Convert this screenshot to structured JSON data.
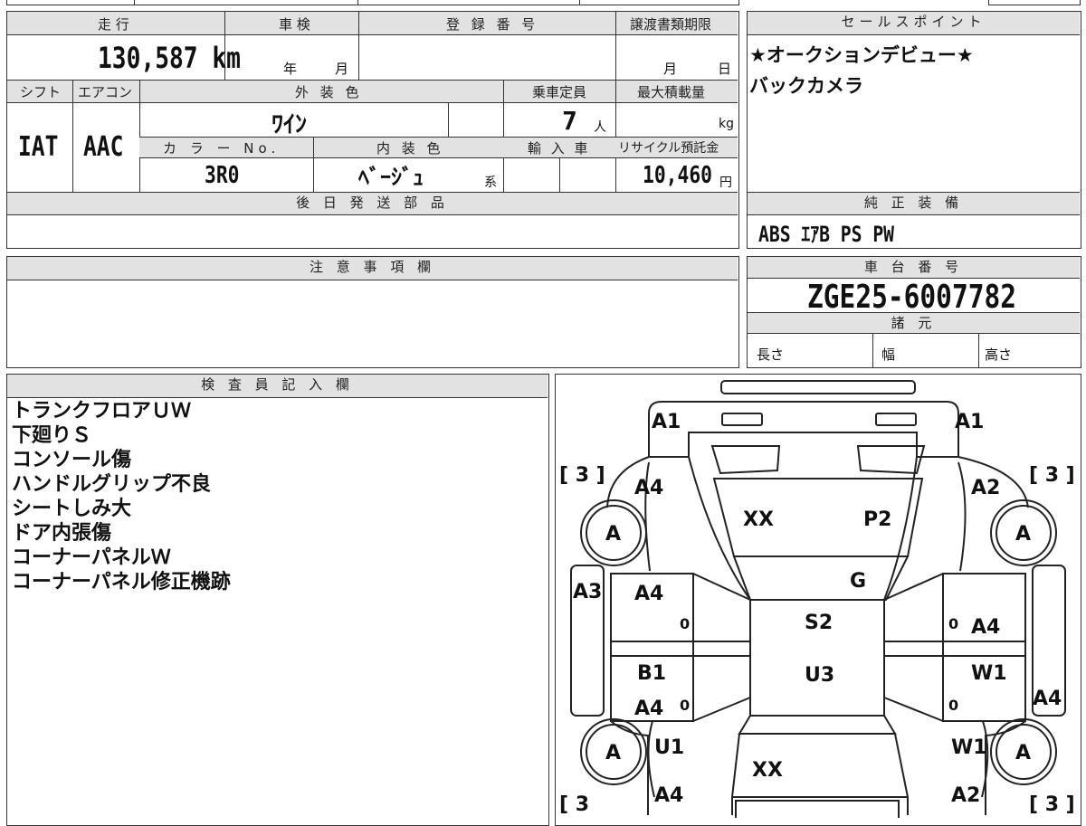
{
  "top_strip": {
    "label": ""
  },
  "specs": {
    "mileage": {
      "label": "走 行",
      "value": "130,587 km"
    },
    "inspection": {
      "label": "車 検",
      "year_unit": "年",
      "month_unit": "月"
    },
    "registration": {
      "label": "登 録 番 号",
      "value": ""
    },
    "transfer_deadline": {
      "label": "譲渡書類期限",
      "month_unit": "月",
      "day_unit": "日"
    },
    "shift": {
      "label": "シフト",
      "value": "IAT"
    },
    "aircon": {
      "label": "エアコン",
      "value": "AAC"
    },
    "exterior_color": {
      "label": "外 装 色",
      "value": "ﾜｲﾝ"
    },
    "capacity": {
      "label": "乗車定員",
      "value": "7",
      "unit": "人"
    },
    "max_load": {
      "label": "最大積載量",
      "unit": "kg"
    },
    "color_no": {
      "label": "カ ラ ー No.",
      "value": "3R0"
    },
    "interior_color": {
      "label": "内 装 色",
      "value": "ﾍﾞｰｼﾞｭ",
      "suffix": "系"
    },
    "import": {
      "label": "輸 入 車"
    },
    "recycle_fee": {
      "label": "リサイクル預託金",
      "value": "10,460",
      "unit": "円"
    }
  },
  "sales_points": {
    "label": "セールスポイント",
    "lines": [
      "★オークションデビュー★",
      "バックカメラ"
    ]
  },
  "later_parts": {
    "label": "後 日 発 送 部 品"
  },
  "standard_equipment": {
    "label": "純 正 装 備",
    "value": "ABS ｴｱB PS PW"
  },
  "notes": {
    "label": "注 意 事 項 欄"
  },
  "chassis": {
    "label": "車 台 番 号",
    "value": "ZGE25-6007782"
  },
  "dimensions": {
    "label": "諸 元",
    "length": "長さ",
    "width": "幅",
    "height": "高さ"
  },
  "inspector": {
    "label": "検 査 員 記 入 欄",
    "lines": [
      "トランクフロアＵＷ",
      "下廻りＳ",
      "コンソール傷",
      "ハンドルグリップ不良",
      "シートしみ大",
      "ドア内張傷",
      "コーナーパネルＷ",
      "コーナーパネル修正機跡"
    ]
  },
  "diagram": {
    "bracket_tl": "[ 3 ]",
    "bracket_tr": "[ 3 ]",
    "bracket_bl": "[ 3",
    "bracket_br": "[ 3 ]",
    "tire_fl": "A",
    "tire_fr": "A",
    "tire_rl": "A",
    "tire_rr": "A",
    "front_left": "A1",
    "front_right": "A1",
    "fender_left": "A4",
    "fender_right": "A2",
    "hood_left": "XX",
    "hood_right": "P2",
    "windshield": "G",
    "side_left": "A3",
    "side_right": "A4",
    "door_fl": "A4",
    "door_fr": "A4",
    "door_fl_zero": "0",
    "door_fr_zero": "0",
    "roof": "S2",
    "roof2": "U3",
    "door_rl_1": "B1",
    "door_rl_2": "A4",
    "door_rl_zero": "0",
    "door_rr": "W1",
    "door_rr_zero": "0",
    "rear_left": "U1",
    "rear_right": "W1",
    "trunk": "XX",
    "quarter_left": "A4",
    "quarter_right": "A2"
  }
}
